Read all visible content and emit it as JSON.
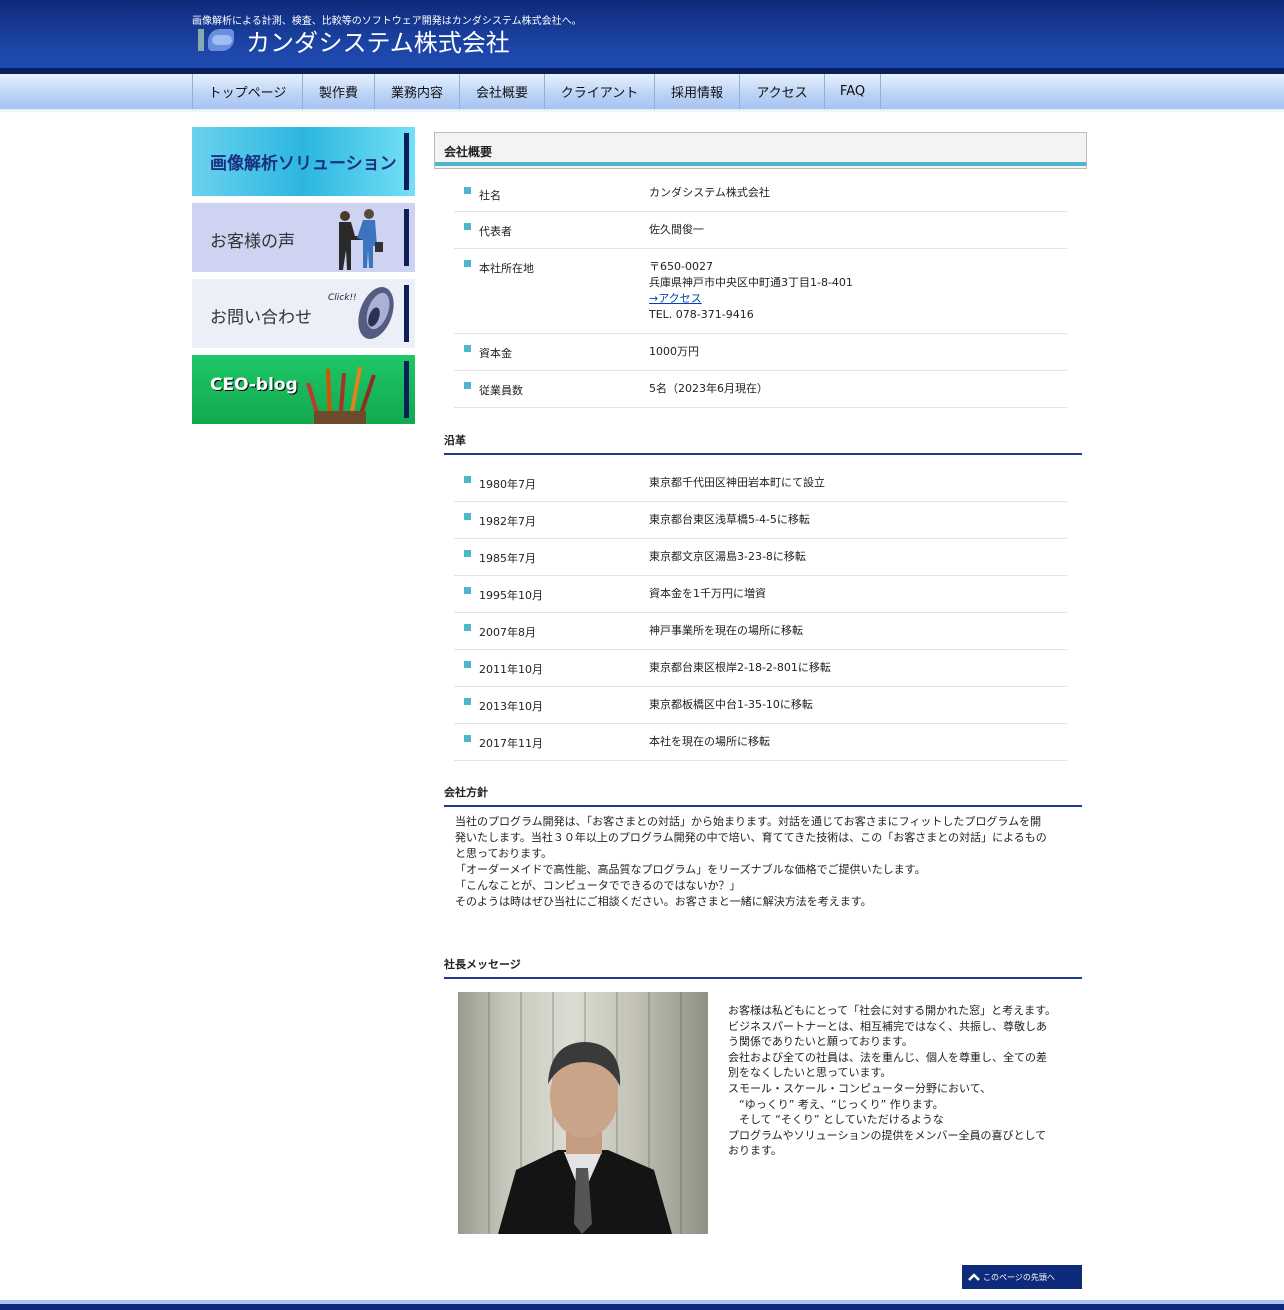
{
  "header": {
    "tagline": "画像解析による計測、検査、比較等のソフトウェア開発はカンダシステム株式会社へ。",
    "company_name": "カンダシステム株式会社"
  },
  "nav": {
    "items": [
      "トップページ",
      "製作費",
      "業務内容",
      "会社概要",
      "クライアント",
      "採用情報",
      "アクセス",
      "FAQ"
    ]
  },
  "sidebar": {
    "banners": [
      {
        "label": "画像解析ソリューション",
        "icon": "image-analysis-icon"
      },
      {
        "label": "お客様の声",
        "icon": "handshake-icon"
      },
      {
        "label": "お問い合わせ",
        "click_text": "Click!!",
        "icon": "mouse-icon"
      },
      {
        "label": "CEO-blog",
        "icon": "pencils-icon"
      }
    ]
  },
  "profile": {
    "title": "会社概要",
    "rows": [
      {
        "key": "社名",
        "lines": [
          "カンダシステム株式会社"
        ]
      },
      {
        "key": "代表者",
        "lines": [
          "佐久間俊一"
        ]
      },
      {
        "key": "本社所在地",
        "lines": [
          "〒650-0027",
          "兵庫県神戸市中央区中町通3丁目1-8-401"
        ],
        "link": "→アクセス",
        "tel": "TEL. 078-371-9416"
      },
      {
        "key": "資本金",
        "lines": [
          "1000万円"
        ]
      },
      {
        "key": "従業員数",
        "lines": [
          "5名（2023年6月現在）"
        ]
      }
    ]
  },
  "history": {
    "title": "沿革",
    "rows": [
      {
        "key": "1980年7月",
        "value": "東京都千代田区神田岩本町にて設立"
      },
      {
        "key": "1982年7月",
        "value": "東京都台東区浅草橋5-4-5に移転"
      },
      {
        "key": "1985年7月",
        "value": "東京都文京区湯島3-23-8に移転"
      },
      {
        "key": "1995年10月",
        "value": "資本金を1千万円に増資"
      },
      {
        "key": "2007年8月",
        "value": "神戸事業所を現在の場所に移転"
      },
      {
        "key": "2011年10月",
        "value": "東京都台東区根岸2-18-2-801に移転"
      },
      {
        "key": "2013年10月",
        "value": "東京都板橋区中台1-35-10に移転"
      },
      {
        "key": "2017年11月",
        "value": "本社を現在の場所に移転"
      }
    ]
  },
  "policy": {
    "title": "会社方針",
    "lines": [
      "当社のプログラム開発は、「お客さまとの対話」から始まります。対話を通じてお客さまにフィットしたプログラムを開",
      "発いたします。当社３０年以上のプログラム開発の中で培い、育ててきた技術は、この「お客さまとの対話」によるもの",
      "と思っております。",
      "「オーダーメイドで高性能、高品質なプログラム」をリーズナブルな価格でご提供いたします。",
      "「こんなことが、コンピュータでできるのではないか？」",
      "そのようは時はぜひ当社にご相談ください。お客さまと一緒に解決方法を考えます。"
    ]
  },
  "message": {
    "title": "社長メッセージ",
    "lines": [
      "お客様は私どもにとって「社会に対する開かれた窓」と考えます。",
      "ビジネスパートナーとは、相互補完ではなく、共振し、尊敬しあ",
      "う関係でありたいと願っております。",
      "会社および全ての社員は、法を重んじ、個人を尊重し、全ての差",
      "別をなくしたいと思っています。",
      "スモール・スケール・コンピューター分野において、",
      "　“ゆっくり” 考え、“じっくり” 作ります。",
      "　そして “そくり” としていただけるような",
      "プログラムやソリューションの提供をメンバー全員の喜びとして",
      "おります。"
    ]
  },
  "footer": {
    "to_top": "このページの先頭へ"
  }
}
